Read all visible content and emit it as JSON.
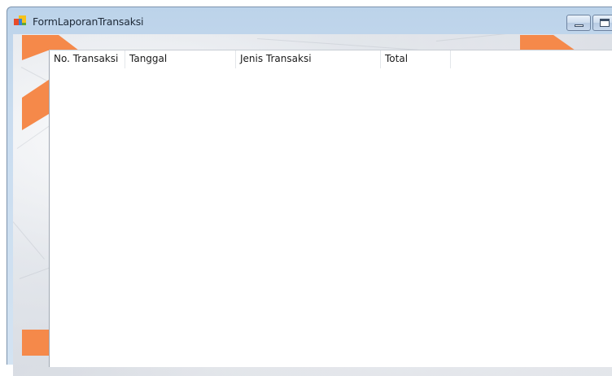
{
  "window": {
    "title": "FormLaporanTransaksi",
    "app_icon": "windows-form-icon",
    "caption_buttons": [
      "minimize-icon",
      "maximize-icon"
    ]
  },
  "listview": {
    "columns": [
      {
        "label": "No. Transaksi"
      },
      {
        "label": "Tanggal"
      },
      {
        "label": "Jenis Transaksi"
      },
      {
        "label": "Total"
      }
    ],
    "rows": []
  },
  "colors": {
    "accent_orange": "#f5894a",
    "frame_blue": "#c9dcef",
    "list_background": "#ffffff"
  }
}
